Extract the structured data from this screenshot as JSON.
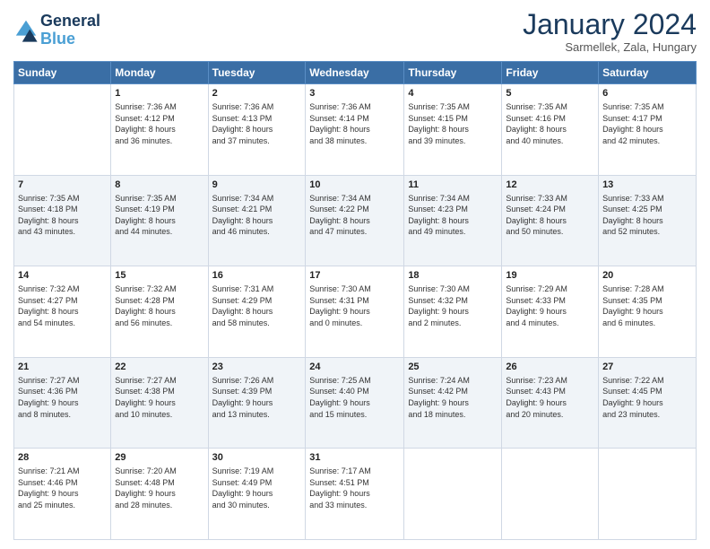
{
  "logo": {
    "line1": "General",
    "line2": "Blue"
  },
  "title": "January 2024",
  "subtitle": "Sarmellek, Zala, Hungary",
  "days_header": [
    "Sunday",
    "Monday",
    "Tuesday",
    "Wednesday",
    "Thursday",
    "Friday",
    "Saturday"
  ],
  "weeks": [
    [
      {
        "day": "",
        "info": ""
      },
      {
        "day": "1",
        "info": "Sunrise: 7:36 AM\nSunset: 4:12 PM\nDaylight: 8 hours\nand 36 minutes."
      },
      {
        "day": "2",
        "info": "Sunrise: 7:36 AM\nSunset: 4:13 PM\nDaylight: 8 hours\nand 37 minutes."
      },
      {
        "day": "3",
        "info": "Sunrise: 7:36 AM\nSunset: 4:14 PM\nDaylight: 8 hours\nand 38 minutes."
      },
      {
        "day": "4",
        "info": "Sunrise: 7:35 AM\nSunset: 4:15 PM\nDaylight: 8 hours\nand 39 minutes."
      },
      {
        "day": "5",
        "info": "Sunrise: 7:35 AM\nSunset: 4:16 PM\nDaylight: 8 hours\nand 40 minutes."
      },
      {
        "day": "6",
        "info": "Sunrise: 7:35 AM\nSunset: 4:17 PM\nDaylight: 8 hours\nand 42 minutes."
      }
    ],
    [
      {
        "day": "7",
        "info": "Sunrise: 7:35 AM\nSunset: 4:18 PM\nDaylight: 8 hours\nand 43 minutes."
      },
      {
        "day": "8",
        "info": "Sunrise: 7:35 AM\nSunset: 4:19 PM\nDaylight: 8 hours\nand 44 minutes."
      },
      {
        "day": "9",
        "info": "Sunrise: 7:34 AM\nSunset: 4:21 PM\nDaylight: 8 hours\nand 46 minutes."
      },
      {
        "day": "10",
        "info": "Sunrise: 7:34 AM\nSunset: 4:22 PM\nDaylight: 8 hours\nand 47 minutes."
      },
      {
        "day": "11",
        "info": "Sunrise: 7:34 AM\nSunset: 4:23 PM\nDaylight: 8 hours\nand 49 minutes."
      },
      {
        "day": "12",
        "info": "Sunrise: 7:33 AM\nSunset: 4:24 PM\nDaylight: 8 hours\nand 50 minutes."
      },
      {
        "day": "13",
        "info": "Sunrise: 7:33 AM\nSunset: 4:25 PM\nDaylight: 8 hours\nand 52 minutes."
      }
    ],
    [
      {
        "day": "14",
        "info": "Sunrise: 7:32 AM\nSunset: 4:27 PM\nDaylight: 8 hours\nand 54 minutes."
      },
      {
        "day": "15",
        "info": "Sunrise: 7:32 AM\nSunset: 4:28 PM\nDaylight: 8 hours\nand 56 minutes."
      },
      {
        "day": "16",
        "info": "Sunrise: 7:31 AM\nSunset: 4:29 PM\nDaylight: 8 hours\nand 58 minutes."
      },
      {
        "day": "17",
        "info": "Sunrise: 7:30 AM\nSunset: 4:31 PM\nDaylight: 9 hours\nand 0 minutes."
      },
      {
        "day": "18",
        "info": "Sunrise: 7:30 AM\nSunset: 4:32 PM\nDaylight: 9 hours\nand 2 minutes."
      },
      {
        "day": "19",
        "info": "Sunrise: 7:29 AM\nSunset: 4:33 PM\nDaylight: 9 hours\nand 4 minutes."
      },
      {
        "day": "20",
        "info": "Sunrise: 7:28 AM\nSunset: 4:35 PM\nDaylight: 9 hours\nand 6 minutes."
      }
    ],
    [
      {
        "day": "21",
        "info": "Sunrise: 7:27 AM\nSunset: 4:36 PM\nDaylight: 9 hours\nand 8 minutes."
      },
      {
        "day": "22",
        "info": "Sunrise: 7:27 AM\nSunset: 4:38 PM\nDaylight: 9 hours\nand 10 minutes."
      },
      {
        "day": "23",
        "info": "Sunrise: 7:26 AM\nSunset: 4:39 PM\nDaylight: 9 hours\nand 13 minutes."
      },
      {
        "day": "24",
        "info": "Sunrise: 7:25 AM\nSunset: 4:40 PM\nDaylight: 9 hours\nand 15 minutes."
      },
      {
        "day": "25",
        "info": "Sunrise: 7:24 AM\nSunset: 4:42 PM\nDaylight: 9 hours\nand 18 minutes."
      },
      {
        "day": "26",
        "info": "Sunrise: 7:23 AM\nSunset: 4:43 PM\nDaylight: 9 hours\nand 20 minutes."
      },
      {
        "day": "27",
        "info": "Sunrise: 7:22 AM\nSunset: 4:45 PM\nDaylight: 9 hours\nand 23 minutes."
      }
    ],
    [
      {
        "day": "28",
        "info": "Sunrise: 7:21 AM\nSunset: 4:46 PM\nDaylight: 9 hours\nand 25 minutes."
      },
      {
        "day": "29",
        "info": "Sunrise: 7:20 AM\nSunset: 4:48 PM\nDaylight: 9 hours\nand 28 minutes."
      },
      {
        "day": "30",
        "info": "Sunrise: 7:19 AM\nSunset: 4:49 PM\nDaylight: 9 hours\nand 30 minutes."
      },
      {
        "day": "31",
        "info": "Sunrise: 7:17 AM\nSunset: 4:51 PM\nDaylight: 9 hours\nand 33 minutes."
      },
      {
        "day": "",
        "info": ""
      },
      {
        "day": "",
        "info": ""
      },
      {
        "day": "",
        "info": ""
      }
    ]
  ]
}
